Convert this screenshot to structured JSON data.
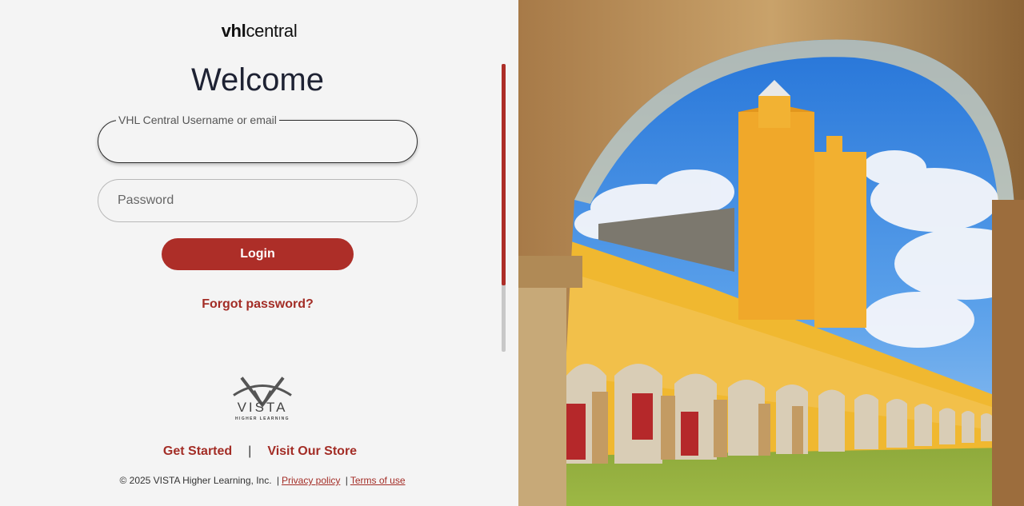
{
  "logo": {
    "bold": "vhl",
    "light": "central"
  },
  "heading": "Welcome",
  "username": {
    "label": "VHL Central Username or email",
    "value": ""
  },
  "password": {
    "placeholder": "Password"
  },
  "login_button": "Login",
  "forgot_link": "Forgot password?",
  "brand": {
    "name": "VISTA",
    "tagline": "HIGHER LEARNING"
  },
  "links": {
    "get_started": "Get Started",
    "separator": "|",
    "visit_store": "Visit Our Store"
  },
  "footer": {
    "copyright": "© 2025 VISTA Higher Learning, Inc.",
    "separator": "|",
    "privacy": "Privacy policy",
    "terms": "Terms of use"
  },
  "colors": {
    "accent": "#ad2e28",
    "link": "#a32d26",
    "background": "#f4f4f4"
  },
  "hero_image": "Yellow colonial convent with arched arcade seen through a stone archway under blue sky"
}
